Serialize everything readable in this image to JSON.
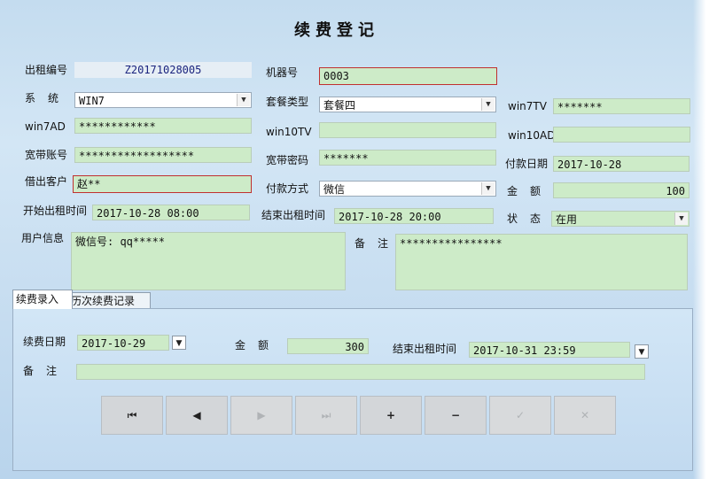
{
  "title": "续费登记",
  "rental_no": {
    "label": "出租编号",
    "value": "Z20171028005"
  },
  "machine_no": {
    "label": "机器号",
    "value": "0003"
  },
  "system": {
    "label": "系统",
    "value": "WIN7"
  },
  "package_type": {
    "label": "套餐类型",
    "value": "套餐四"
  },
  "win7tv": {
    "label": "win7TV",
    "value": "*******"
  },
  "win7ad": {
    "label": "win7AD",
    "value": "************"
  },
  "win10tv": {
    "label": "win10TV",
    "value": ""
  },
  "win10ad": {
    "label": "win10AD",
    "value": ""
  },
  "broadband_account": {
    "label": "宽带账号",
    "value": "******************"
  },
  "broadband_password": {
    "label": "宽带密码",
    "value": "*******"
  },
  "payment_date": {
    "label": "付款日期",
    "value": "2017-10-28"
  },
  "customer": {
    "label": "借出客户",
    "value": "赵**"
  },
  "payment_method": {
    "label": "付款方式",
    "value": "微信"
  },
  "amount": {
    "label": "金额",
    "value": "100"
  },
  "start_time": {
    "label": "开始出租时间",
    "value": "2017-10-28 08:00"
  },
  "end_time": {
    "label": "结束出租时间",
    "value": "2017-10-28 20:00"
  },
  "status": {
    "label": "状态",
    "value": "在用"
  },
  "user_info": {
    "label": "用户信息",
    "value": "微信号: qq*****"
  },
  "remark": {
    "label": "备注",
    "value": "****************"
  },
  "tabs": [
    {
      "label": "续费录入",
      "active": true
    },
    {
      "label": "历次续费记录",
      "active": false
    }
  ],
  "renew": {
    "date_label": "续费日期",
    "date_value": "2017-10-29",
    "amount_label": "金额",
    "amount_value": "300",
    "end_label": "结束出租时间",
    "end_value": "2017-10-31 23:59",
    "remark_label": "备注",
    "remark_value": ""
  },
  "nav_buttons": [
    {
      "name": "first",
      "icon": "⏮",
      "enabled": true
    },
    {
      "name": "prev",
      "icon": "◀",
      "enabled": true
    },
    {
      "name": "next",
      "icon": "▶",
      "enabled": false
    },
    {
      "name": "last",
      "icon": "⏭",
      "enabled": false
    },
    {
      "name": "add",
      "icon": "+",
      "enabled": true
    },
    {
      "name": "delete",
      "icon": "−",
      "enabled": true
    },
    {
      "name": "save",
      "icon": "✓",
      "enabled": false
    },
    {
      "name": "cancel",
      "icon": "✕",
      "enabled": false
    }
  ],
  "icons": {
    "dropdown": "chevron-down-icon",
    "date_picker": "date-picker-icon"
  },
  "colors": {
    "field_bg": "#cdebc8",
    "error_border": "#c03030",
    "background": "#c8def1"
  }
}
